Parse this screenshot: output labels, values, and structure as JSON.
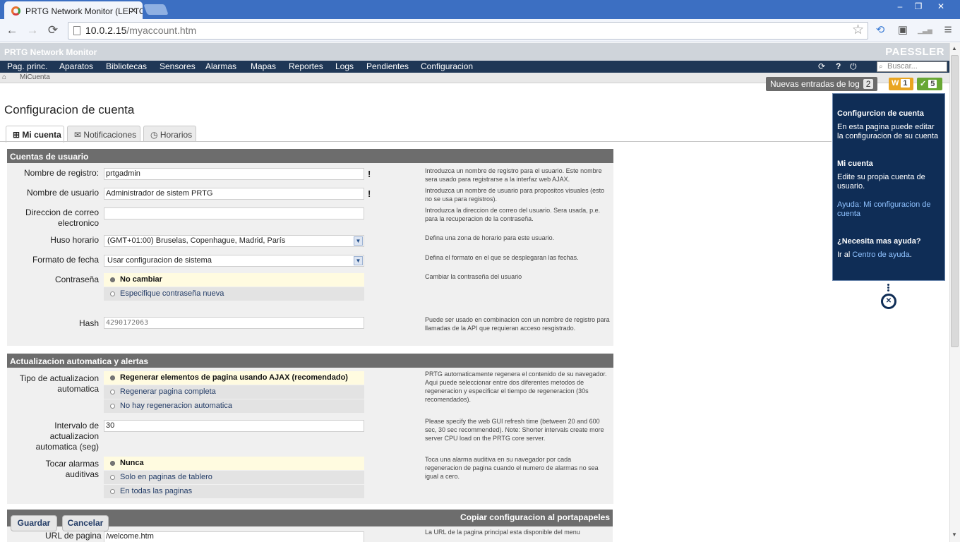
{
  "browser": {
    "tab_title": "PRTG Network Monitor (LEPTO",
    "tab_close": "✕",
    "url_host": "10.0.2.15",
    "url_path": "/myaccount.htm",
    "window_controls": {
      "minimize": "–",
      "restore": "❐",
      "close": "✕"
    },
    "back_icon": "←",
    "forward_icon": "→",
    "reload_icon": "⟳",
    "star_icon": "☆",
    "menu_icon": "≡",
    "ext_icons": [
      "⟲",
      "▣",
      "▁▃▅"
    ]
  },
  "app": {
    "title": "PRTG Network Monitor",
    "brand": "PAESSLER"
  },
  "nav": {
    "items": [
      "Pag. princ.",
      "Aparatos",
      "Bibliotecas",
      "Sensores",
      "Alarmas",
      "Mapas",
      "Reportes",
      "Logs",
      "Pendientes",
      "Configuracion"
    ],
    "refresh_icon": "⟳",
    "help_icon": "?",
    "logout_icon": "⏻",
    "search_placeholder": "Buscar..."
  },
  "breadcrumb": {
    "home_icon": "⌂",
    "current": "MiCuenta"
  },
  "status": {
    "log_label": "Nuevas entradas de log",
    "log_count": "2",
    "warn_letter": "W",
    "warn_count": "1",
    "ok_mark": "✓",
    "ok_count": "5"
  },
  "page": {
    "title": "Configuracion de cuenta",
    "tabs": [
      {
        "icon": "⊞",
        "label": "Mi cuenta"
      },
      {
        "icon": "✉",
        "label": "Notificaciones"
      },
      {
        "icon": "◷",
        "label": "Horarios"
      }
    ]
  },
  "user_section": {
    "heading": "Cuentas de usuario",
    "login_label": "Nombre de registro:",
    "login_value": "prtgadmin",
    "login_help": "Introduzca un nombre de registro para el usuario. Este nombre sera usado para registrarse a la interfaz web AJAX.",
    "username_label": "Nombre de usuario",
    "username_value": "Administrador de sistem PRTG",
    "username_help": "Introduzca un nombre de usuario para propositos visuales (esto no se usa para registros).",
    "email_label": "Direccion de correo electronico",
    "email_value": "",
    "email_help": "Introduzca la direccion de correo del usuario. Sera usada, p.e. para la recuperacion de la contraseña.",
    "tz_label": "Huso horario",
    "tz_value": "(GMT+01:00) Bruselas, Copenhague, Madrid, París",
    "tz_help": "Defina una zona de horario para este usuario.",
    "date_label": "Formato de fecha",
    "date_value": "Usar configuracion de sistema",
    "date_help": "Defina el formato en el que se desplegaran las fechas.",
    "pw_label": "Contraseña",
    "pw_options": [
      "No cambiar",
      "Especifique contraseña nueva"
    ],
    "pw_help": "Cambiar la contraseña del usuario",
    "hash_label": "Hash",
    "hash_value": "4290172063",
    "hash_help": "Puede ser usado en combinacion con un nombre de registro para llamadas de la API que requieran acceso resgistrado.",
    "required_mark": "!"
  },
  "refresh_section": {
    "heading": "Actualizacion automatica y alertas",
    "type_label": "Tipo de actualizacion automatica",
    "type_options": [
      "Regenerar elementos de pagina usando AJAX (recomendado)",
      "Regenerar pagina completa",
      "No hay regeneracion automatica"
    ],
    "type_help": "PRTG automaticamente regenera el contenido de su navegador. Aqui puede seleccionar entre dos diferentes metodos de regeneracion y especificar el tiempo de regeneracion (30s recomendados).",
    "interval_label": "Intervalo de actualizacion automatica (seg)",
    "interval_value": "30",
    "interval_help": "Please specify the web GUI refresh time (between 20 and 600 sec, 30 sec recommended). Note: Shorter intervals create more server CPU load on the PRTG core server.",
    "alarm_label": "Tocar alarmas auditivas",
    "alarm_options": [
      "Nunca",
      "Solo en paginas de tablero",
      "En todas las paginas"
    ],
    "alarm_help": "Toca una alarma auditiva en su navegador por cada regeneracion de pagina cuando el numero de alarmas no sea igual a cero."
  },
  "footer": {
    "copy_label": "Copiar configuracion al portapapeles",
    "save": "Guardar",
    "cancel": "Cancelar",
    "partial_label": "URL de pagina",
    "partial_value": "/welcome.htm",
    "partial_help": "La URL de la pagina principal esta disponible del menu"
  },
  "help_panel": {
    "title": "Configurcion de cuenta",
    "intro": "En esta pagina puede editar la configuracion de su cuenta",
    "section_title": "Mi cuenta",
    "section_text": "Edite su propia cuenta de usuario.",
    "help_link": "Ayuda: Mi configuracion de cuenta",
    "more_title": "¿Necesita mas ayuda?",
    "more_prefix": "Ir al",
    "more_link": "Centro de ayuda",
    "more_suffix": ".",
    "close_icon": "✕"
  },
  "scroll": {
    "up": "▲",
    "down": "▼"
  },
  "colors": {
    "nav_bg": "#1f3756",
    "help_bg": "#0f2d56",
    "section_head": "#6d6d6d",
    "warn": "#e9a521",
    "ok": "#68a734"
  }
}
